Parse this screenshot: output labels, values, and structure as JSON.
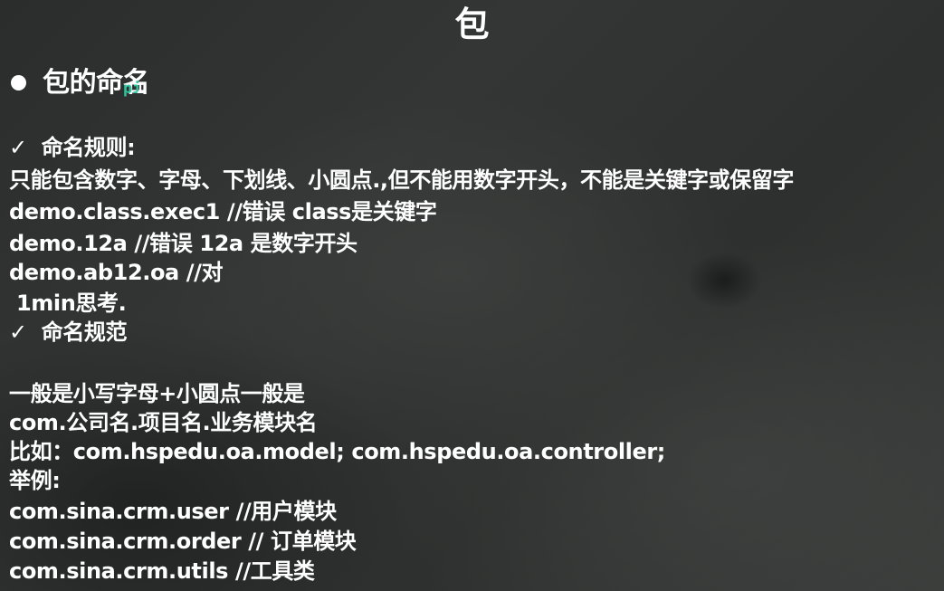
{
  "title": "包",
  "section": {
    "bullet_heading": "包的命名"
  },
  "rules": {
    "check_mark": "✓",
    "heading": "命名规则:",
    "lines": [
      "只能包含数字、字母、下划线、小圆点.,但不能用数字开头，不能是关键字或保留字",
      "demo.class.exec1   //错误 class是关键字",
      "demo.12a  //错误  12a 是数字开头",
      "demo.ab12.oa //对",
      " 1min思考."
    ]
  },
  "conventions": {
    "check_mark": "✓",
    "heading": "命名规范",
    "lines": [
      "一般是小写字母+小圆点一般是",
      "com.公司名.项目名.业务模块名",
      "比如：com.hspedu.oa.model;  com.hspedu.oa.controller;",
      "举例:",
      "com.sina.crm.user //用户模块",
      "com.sina.crm.order // 订单模块",
      "com.sina.crm.utils //工具类"
    ]
  },
  "cursor_label": "pi"
}
